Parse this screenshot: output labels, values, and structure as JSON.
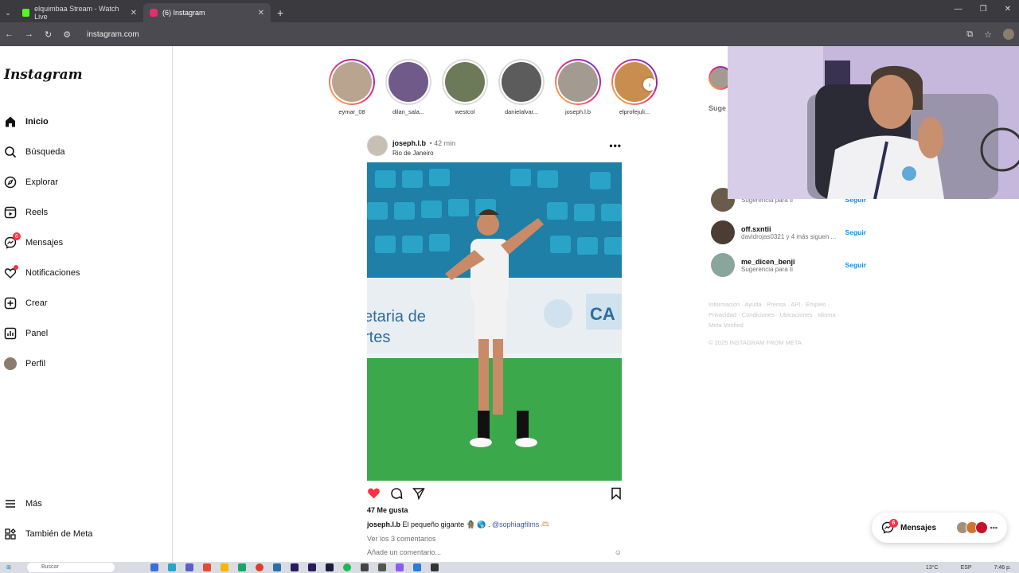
{
  "browser": {
    "tabs": [
      {
        "title": "elquimbaa Stream - Watch Live",
        "active": false,
        "favicon_color": "#53fc18"
      },
      {
        "title": "(6) Instagram",
        "active": true,
        "favicon_color": "#e1306c"
      }
    ],
    "url": "instagram.com"
  },
  "sidebar": {
    "logo": "Instagram",
    "items": [
      {
        "label": "Inicio",
        "icon": "home-icon",
        "bold": true
      },
      {
        "label": "Búsqueda",
        "icon": "search-icon"
      },
      {
        "label": "Explorar",
        "icon": "compass-icon"
      },
      {
        "label": "Reels",
        "icon": "reels-icon"
      },
      {
        "label": "Mensajes",
        "icon": "messenger-icon",
        "badge": "6"
      },
      {
        "label": "Notificaciones",
        "icon": "heart-icon",
        "dot": true
      },
      {
        "label": "Crear",
        "icon": "plus-square-icon"
      },
      {
        "label": "Panel",
        "icon": "chart-icon"
      },
      {
        "label": "Perfil",
        "icon": "avatar"
      }
    ],
    "bottom": [
      {
        "label": "Más",
        "icon": "menu-icon"
      },
      {
        "label": "También de Meta",
        "icon": "grid-icon"
      }
    ]
  },
  "stories": [
    {
      "name": "eymar_08",
      "seen": false,
      "color": "#b9a48f"
    },
    {
      "name": "dilan_sala...",
      "seen": true,
      "color": "#6f5a8a"
    },
    {
      "name": "westcol",
      "seen": true,
      "color": "#6d7a5a"
    },
    {
      "name": "danielalvar...",
      "seen": true,
      "color": "#5c5c5c"
    },
    {
      "name": "joseph.l.b",
      "seen": false,
      "color": "#a39b92"
    },
    {
      "name": "elprofejuli...",
      "seen": false,
      "color": "#c98e4f"
    }
  ],
  "post": {
    "user": "joseph.l.b",
    "time": "• 42 min",
    "location": "Rio de Janeiro",
    "likes": "47 Me gusta",
    "caption_text": "El pequeño gigante 🧌 🌎 .",
    "caption_mention": "@sophiagfilms 🫶🏻",
    "comments": "Ver los 3 comentarios",
    "add_comment": "Añade un comentario..."
  },
  "suggestions": {
    "title": "Suge",
    "items": [
      {
        "name": "",
        "sub": "Sugerencia para ti",
        "follow": "Seguir",
        "color": "#6b5b4b"
      },
      {
        "name": "off.sxntii",
        "sub": "davidrojas0321 y 4 más siguen ...",
        "follow": "Seguir",
        "color": "#4b3d33"
      },
      {
        "name": "me_dicen_benji",
        "sub": "Sugerencia para ti",
        "follow": "Seguir",
        "color": "#8aa59b"
      }
    ]
  },
  "footer": {
    "links": "Información · Ayuda · Prensa · API · Empleo · Privacidad · Condiciones · Ubicaciones · Idioma · Meta Verified",
    "copyright": "© 2025 INSTAGRAM FROM META"
  },
  "messages_pill": {
    "label": "Mensajes",
    "badge": "6"
  },
  "taskbar": {
    "search": "Buscar",
    "temp": "13°C",
    "lang": "ESP",
    "time": "7:46 p."
  }
}
